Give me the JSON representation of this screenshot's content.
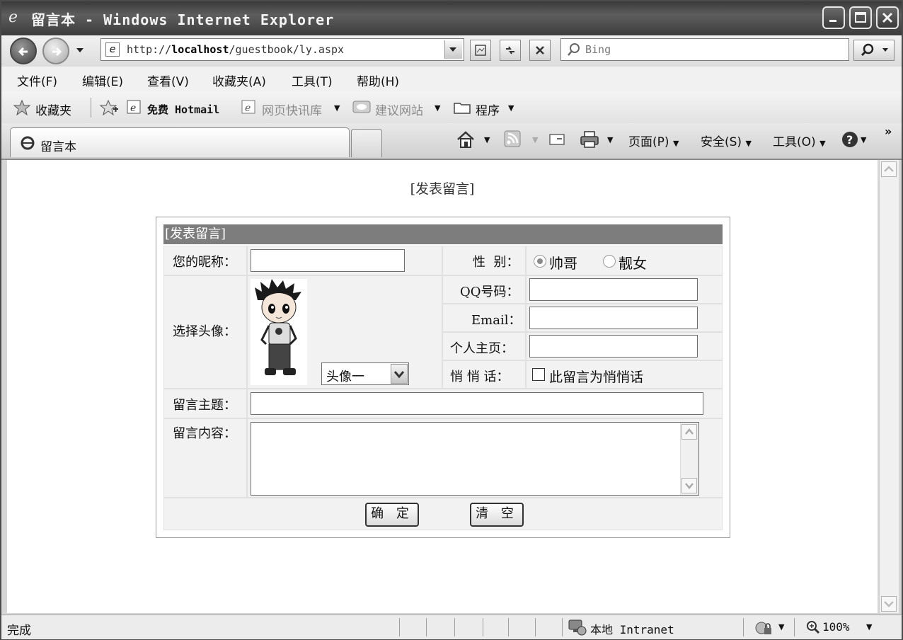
{
  "window": {
    "title": "留言本 - Windows Internet Explorer"
  },
  "address": {
    "url_prefix": "http://",
    "url_host": "localhost",
    "url_path": "/guestbook/ly.aspx"
  },
  "search": {
    "placeholder": "Bing"
  },
  "menu": [
    "文件(F)",
    "编辑(E)",
    "查看(V)",
    "收藏夹(A)",
    "工具(T)",
    "帮助(H)"
  ],
  "favorites": {
    "favorites_label": "收藏夹",
    "hotmail": "免费 Hotmail",
    "webslice": "网页快讯库",
    "suggested": "建议网站",
    "programs": "程序"
  },
  "tab": {
    "label": "留言本"
  },
  "commands": {
    "page": "页面(P)",
    "safety": "安全(S)",
    "tools": "工具(O)"
  },
  "page": {
    "heading": "[发表留言]",
    "form": {
      "header": "[发表留言]",
      "nickname_label": "您的昵称：",
      "gender_label": "性  别：",
      "gender_options": [
        "帅哥",
        "靓女"
      ],
      "gender_selected": "帅哥",
      "avatar_label": "选择头像：",
      "qq_label": "QQ号码：",
      "email_label": "Email：",
      "homepage_label": "个人主页：",
      "whisper_label": "悄 悄 话：",
      "whisper_checkbox": "此留言为悄悄话",
      "avatar_select": "头像一",
      "subject_label": "留言主题：",
      "content_label": "留言内容：",
      "submit": "确 定",
      "clear": "清 空"
    }
  },
  "status": {
    "text": "完成",
    "zone": "本地 Intranet",
    "zoom": "100%"
  }
}
